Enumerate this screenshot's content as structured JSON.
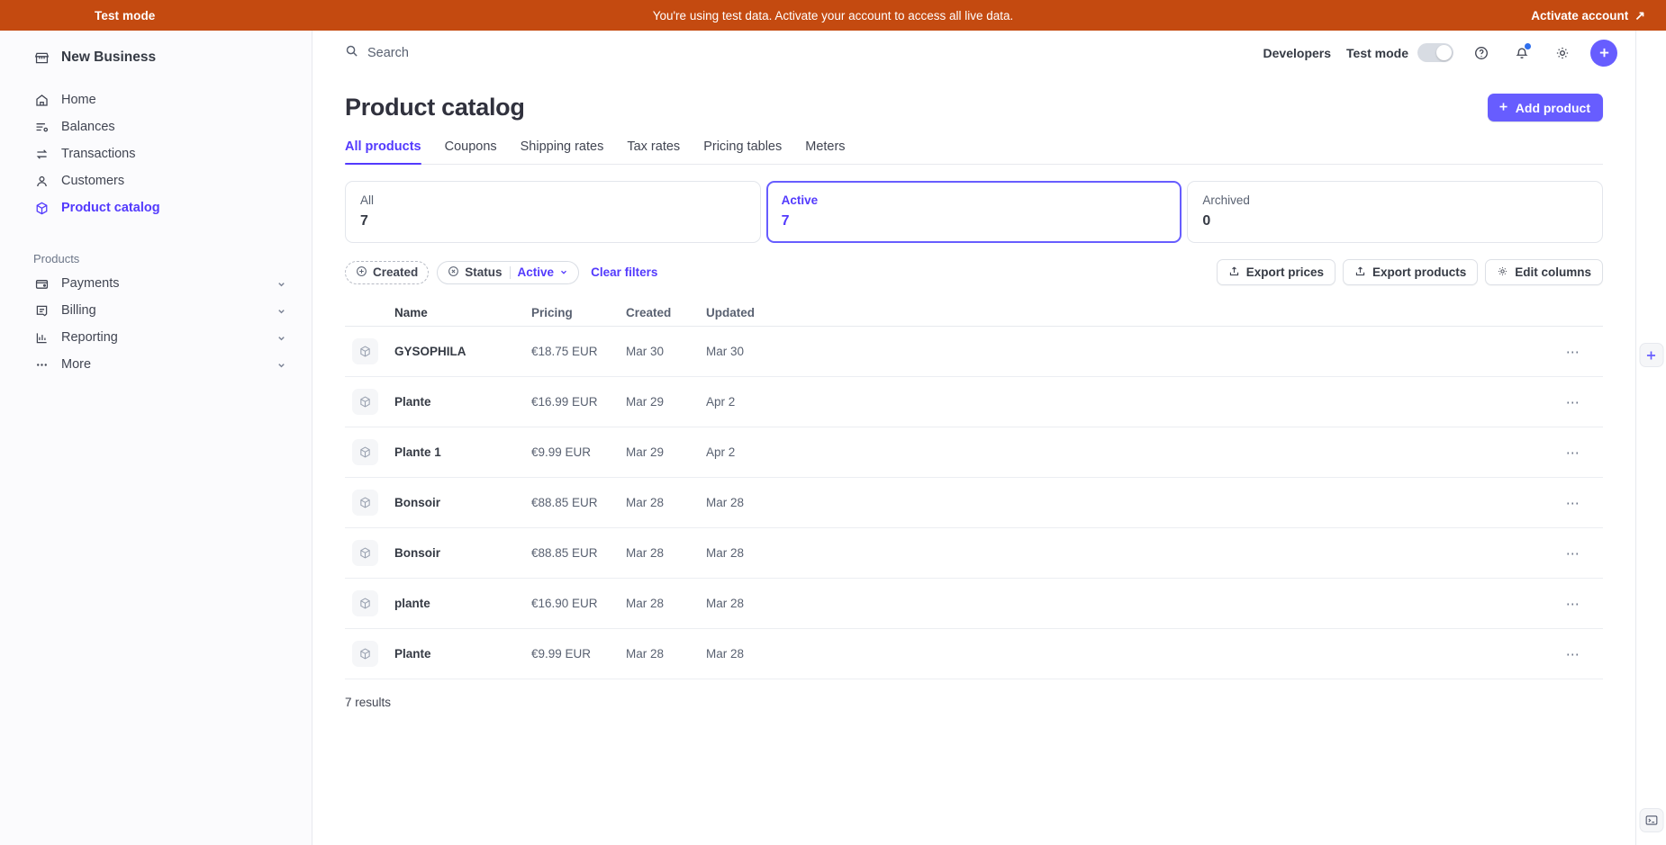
{
  "banner": {
    "mode_label": "Test mode",
    "message": "You're using test data. Activate your account to access all live data.",
    "activate_label": "Activate account",
    "activate_icon": "arrow-up-right-icon",
    "background": "#c44a10"
  },
  "sidebar": {
    "business_name": "New Business",
    "business_icon": "store-icon",
    "items": [
      {
        "label": "Home",
        "icon": "home-icon",
        "active": false
      },
      {
        "label": "Balances",
        "icon": "balances-icon",
        "active": false
      },
      {
        "label": "Transactions",
        "icon": "transactions-icon",
        "active": false
      },
      {
        "label": "Customers",
        "icon": "customers-icon",
        "active": false
      },
      {
        "label": "Product catalog",
        "icon": "product-box-icon",
        "active": true
      }
    ],
    "section_label": "Products",
    "sections": [
      {
        "label": "Payments",
        "icon": "wallet-icon",
        "chevron": "chevron-down-icon"
      },
      {
        "label": "Billing",
        "icon": "billing-icon",
        "chevron": "chevron-down-icon"
      },
      {
        "label": "Reporting",
        "icon": "reporting-icon",
        "chevron": "chevron-down-icon"
      },
      {
        "label": "More",
        "icon": "more-dots-icon",
        "chevron": "chevron-down-icon"
      }
    ]
  },
  "topbar": {
    "search_placeholder": "Search",
    "search_icon": "search-icon",
    "developers_label": "Developers",
    "test_mode_label": "Test mode",
    "test_mode_enabled": false,
    "help_icon": "help-circle-icon",
    "notifications_icon": "bell-icon",
    "settings_icon": "gear-icon",
    "add_icon": "plus-icon"
  },
  "page": {
    "title": "Product catalog",
    "add_product_label": "Add product",
    "add_product_icon": "plus-icon",
    "accent_color": "#675dff"
  },
  "tabs": [
    {
      "label": "All products",
      "active": true
    },
    {
      "label": "Coupons",
      "active": false
    },
    {
      "label": "Shipping rates",
      "active": false
    },
    {
      "label": "Tax rates",
      "active": false
    },
    {
      "label": "Pricing tables",
      "active": false
    },
    {
      "label": "Meters",
      "active": false
    }
  ],
  "status_cards": [
    {
      "label": "All",
      "value": "7",
      "selected": false
    },
    {
      "label": "Active",
      "value": "7",
      "selected": true
    },
    {
      "label": "Archived",
      "value": "0",
      "selected": false
    }
  ],
  "filters": {
    "created": {
      "label": "Created",
      "icon": "plus-circle-icon"
    },
    "status": {
      "label": "Status",
      "icon": "x-circle-icon",
      "value": "Active",
      "chevron": "chevron-down-icon"
    },
    "clear_label": "Clear filters",
    "actions": [
      {
        "label": "Export prices",
        "icon": "export-icon"
      },
      {
        "label": "Export products",
        "icon": "export-icon"
      },
      {
        "label": "Edit columns",
        "icon": "gear-icon"
      }
    ]
  },
  "table": {
    "columns": [
      "Name",
      "Pricing",
      "Created",
      "Updated"
    ],
    "row_icon": "product-box-icon",
    "row_menu_icon": "overflow-menu-icon",
    "rows": [
      {
        "name": "GYSOPHILA",
        "pricing": "€18.75 EUR",
        "created": "Mar 30",
        "updated": "Mar 30"
      },
      {
        "name": "Plante",
        "pricing": "€16.99 EUR",
        "created": "Mar 29",
        "updated": "Apr 2"
      },
      {
        "name": "Plante 1",
        "pricing": "€9.99 EUR",
        "created": "Mar 29",
        "updated": "Apr 2"
      },
      {
        "name": "Bonsoir",
        "pricing": "€88.85 EUR",
        "created": "Mar 28",
        "updated": "Mar 28"
      },
      {
        "name": "Bonsoir",
        "pricing": "€88.85 EUR",
        "created": "Mar 28",
        "updated": "Mar 28"
      },
      {
        "name": "plante",
        "pricing": "€16.90 EUR",
        "created": "Mar 28",
        "updated": "Mar 28"
      },
      {
        "name": "Plante",
        "pricing": "€9.99 EUR",
        "created": "Mar 28",
        "updated": "Mar 28"
      }
    ],
    "results_label": "7 results"
  },
  "rail": {
    "add_icon": "plus-icon",
    "terminal_icon": "terminal-icon"
  }
}
